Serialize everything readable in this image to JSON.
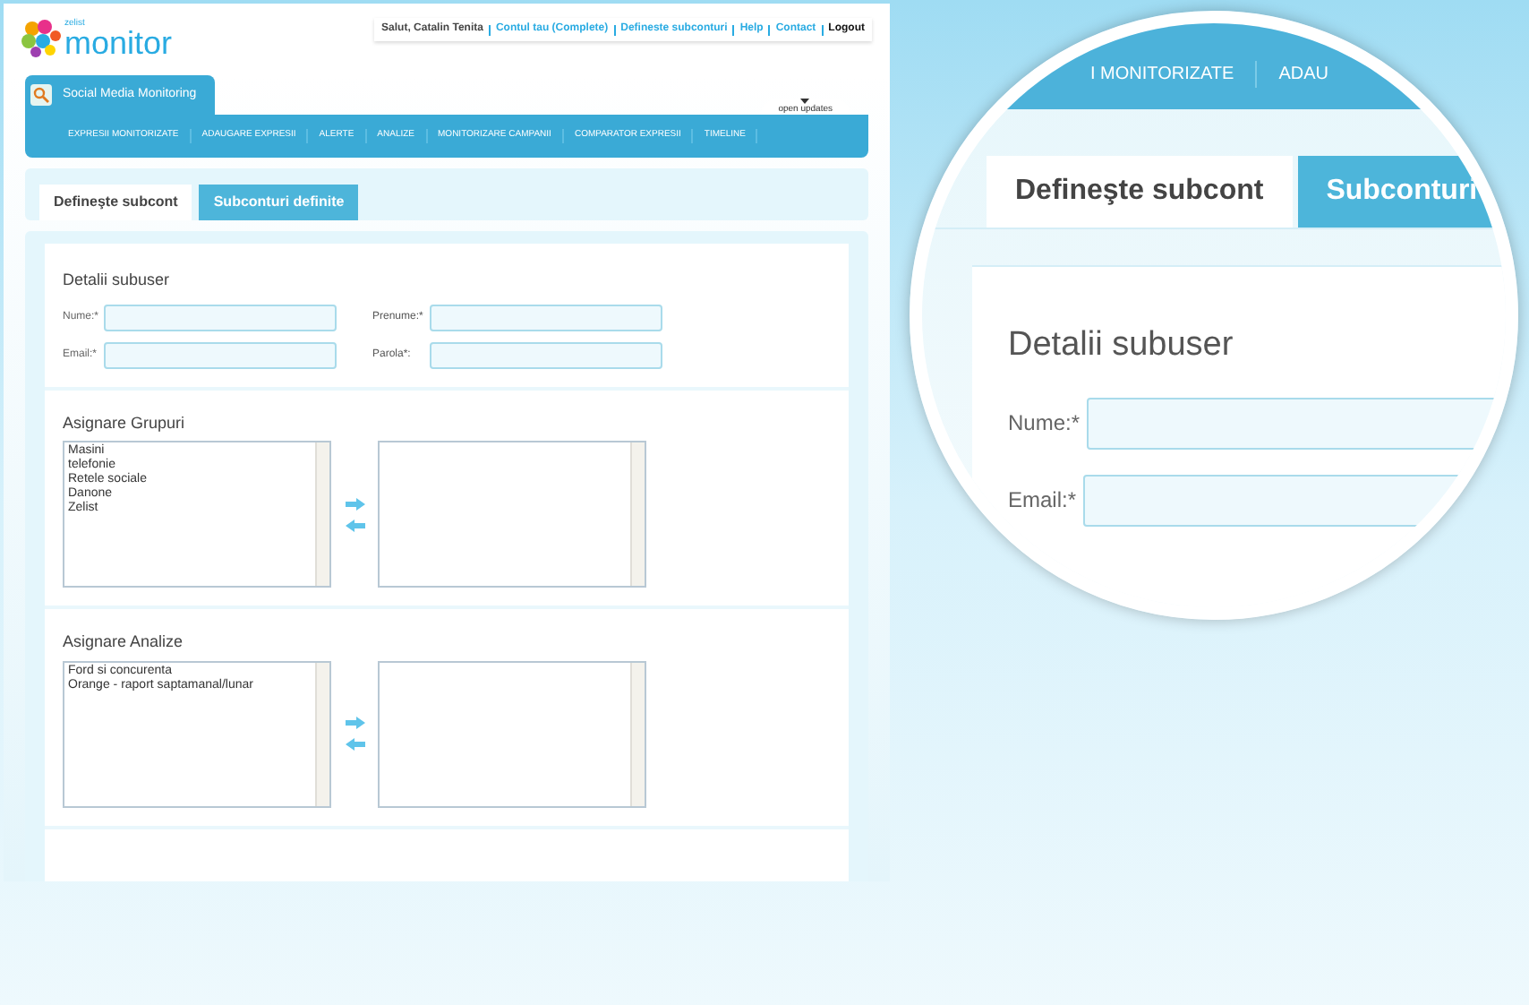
{
  "header": {
    "logo": {
      "small": "zelist",
      "name": "monitor"
    },
    "top_links": [
      {
        "text": "Salut, Catalin Tenita",
        "kind": "greeting"
      },
      {
        "text": "Contul tau (Complete)",
        "kind": "link"
      },
      {
        "text": "Defineste subconturi",
        "kind": "link"
      },
      {
        "text": "Help",
        "kind": "link"
      },
      {
        "text": "Contact",
        "kind": "link"
      },
      {
        "text": "Logout",
        "kind": "strong"
      }
    ]
  },
  "app_tab": {
    "label": "Social Media Monitoring"
  },
  "updates": {
    "label": "open updates"
  },
  "nav": [
    "EXPRESII MONITORIZATE",
    "ADAUGARE EXPRESII",
    "ALERTE",
    "ANALIZE",
    "MONITORIZARE CAMPANII",
    "COMPARATOR EXPRESII",
    "TIMELINE"
  ],
  "tabs": [
    {
      "label": "Defineşte subcont",
      "selected": true
    },
    {
      "label": "Subconturi definite",
      "selected": false
    }
  ],
  "details": {
    "title": "Detalii subuser",
    "fields": [
      {
        "label": "Nume:*"
      },
      {
        "label": "Prenume:*"
      },
      {
        "label": "Email:*"
      },
      {
        "label": "Parola*:"
      }
    ]
  },
  "assign_sections": [
    {
      "title": "Asignare Grupuri",
      "available": [
        "Masini",
        "telefonie",
        "Retele sociale",
        "Danone",
        "Zelist"
      ]
    },
    {
      "title": "Asignare Analize",
      "available": [
        "Ford si concurenta",
        "Orange - raport saptamanal/lunar"
      ]
    }
  ],
  "magnifier": {
    "nav": [
      "I MONITORIZATE",
      "ADAU"
    ],
    "tabs": [
      {
        "label": "Defineşte subcont",
        "selected": true
      },
      {
        "label": "Subconturi",
        "selected": false
      }
    ],
    "title": "Detalii subuser",
    "fields": [
      {
        "label": "Nume:*"
      },
      {
        "label": "Email:*"
      }
    ]
  }
}
